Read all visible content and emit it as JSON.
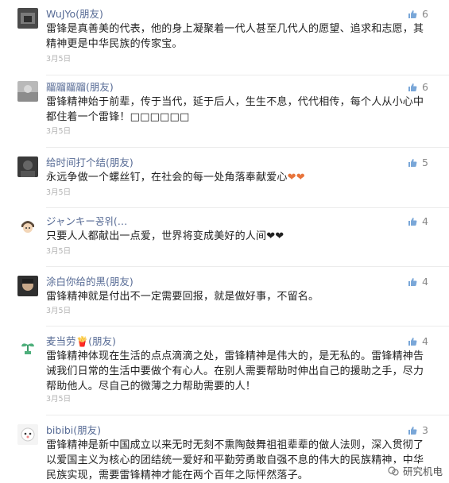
{
  "comments": [
    {
      "nick": "WuJYo(朋友)",
      "likes": "6",
      "text": "雷锋是真善美的代表，他的身上凝聚着一代人甚至几代人的愿望、追求和志愿，其精神更是中华民族的传家宝。",
      "date": "3月5日",
      "avatar_icon": "avatar-photo-icon"
    },
    {
      "nick": "鬸鬸鬸鬸(朋友)",
      "likes": "6",
      "text": "雷锋精神始于前辈，传于当代，延于后人，生生不息，代代相传，每个人从小心中都住着一个雷锋！□□□□□□",
      "date": "3月5日",
      "avatar_icon": "avatar-photo-icon"
    },
    {
      "nick": "给时间打个结(朋友)",
      "likes": "5",
      "text": "永远争做一个螺丝钉，在社会的每一处角落奉献爱心",
      "text_suffix": "❤❤",
      "date": "3月5日",
      "avatar_icon": "avatar-photo-icon"
    },
    {
      "nick": "ジャンキー꽁위(…",
      "likes": "4",
      "text": "只要人人都献出一点爱，世界将变成美好的人间❤❤",
      "date": "3月5日",
      "avatar_icon": "avatar-cartoon-icon"
    },
    {
      "nick": "涂白你给的黑(朋友)",
      "likes": "4",
      "text": "雷锋精神就是付出不一定需要回报，就是做好事，不留名。",
      "date": "3月5日",
      "avatar_icon": "avatar-photo-icon"
    },
    {
      "nick": "麦当劳🍟(朋友)",
      "likes": "4",
      "text": "雷锋精神体现在生活的点点滴滴之处，雷锋精神是伟大的，是无私的。雷锋精神告诫我们日常的生活中要做个有心人。在别人需要帮助时伸出自己的援助之手，尽力帮助他人。尽自己的微薄之力帮助需要的人！",
      "date": "3月5日",
      "avatar_icon": "avatar-plant-icon"
    },
    {
      "nick": "bibibi(朋友)",
      "likes": "3",
      "text": "雷锋精神是新中国成立以来无时无刻不熏陶鼓舞祖祖辈辈的做人法则，深入贯彻了以爱国主义为核心的团结统一爱好和平勤劳勇敢自强不息的伟大的民族精神，中华民族实现，需要雷锋精神才能在两个百年之际怦然落子。",
      "date": "",
      "avatar_icon": "avatar-cartoon-icon"
    }
  ],
  "watermark": {
    "text": "研究机电"
  },
  "colors": {
    "nick": "#576b95",
    "date": "#b2b2b2",
    "likes": "#888888"
  }
}
